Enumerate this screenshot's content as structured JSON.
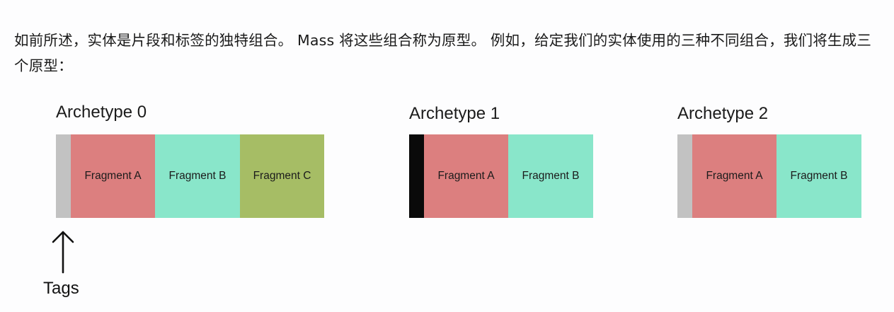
{
  "intro_text": "如前所述，实体是片段和标签的独特组合。 Mass 将这些组合称为原型。 例如，给定我们的实体使用的三种不同组合，我们将生成三个原型：",
  "colors": {
    "tag_light": "#c2c2c2",
    "tag_dark": "#0a0a0a",
    "fragment_a": "#dc7f7f",
    "fragment_b": "#89e6ca",
    "fragment_c": "#a6bd65"
  },
  "archetypes": [
    {
      "title": "Archetype 0",
      "tag_color": "#c2c2c2",
      "fragments": [
        "Fragment A",
        "Fragment B",
        "Fragment C"
      ]
    },
    {
      "title": "Archetype 1",
      "tag_color": "#0a0a0a",
      "fragments": [
        "Fragment A",
        "Fragment B"
      ]
    },
    {
      "title": "Archetype 2",
      "tag_color": "#c2c2c2",
      "fragments": [
        "Fragment A",
        "Fragment B"
      ]
    }
  ],
  "annotation": {
    "label": "Tags",
    "icon": "up-arrow-icon"
  }
}
